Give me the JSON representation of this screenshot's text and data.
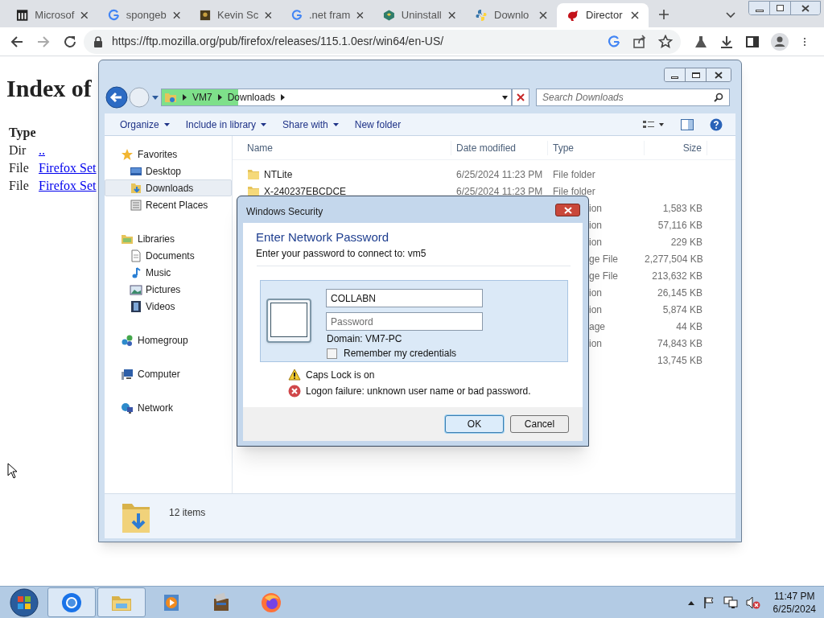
{
  "browser": {
    "tabs": [
      {
        "kind": "columns",
        "label": "Microsof",
        "selected": false
      },
      {
        "kind": "g",
        "label": "spongeb",
        "selected": false
      },
      {
        "kind": "photo",
        "label": "Kevin Sc",
        "selected": false
      },
      {
        "kind": "g",
        "label": ".net fram",
        "selected": false
      },
      {
        "kind": "cube",
        "label": "Uninstall",
        "selected": false
      },
      {
        "kind": "snake",
        "label": "Downlo",
        "selected": false
      },
      {
        "kind": "dino",
        "label": "Director",
        "selected": true
      }
    ],
    "address": "https://ftp.mozilla.org/pub/firefox/releases/115.1.0esr/win64/en-US/"
  },
  "page": {
    "heading": "Index of",
    "header": "Type",
    "rows": [
      {
        "type": "Dir",
        "link": ".."
      },
      {
        "type": "File",
        "link": "Firefox Set"
      },
      {
        "type": "File",
        "link": "Firefox Set"
      }
    ]
  },
  "explorer": {
    "breadcrumb": [
      "VM7",
      "Downloads"
    ],
    "progress": {
      "level": 0.22
    },
    "search_placeholder": "Search Downloads",
    "toolbar": [
      {
        "label": "Organize",
        "menu": true
      },
      {
        "label": "Include in library",
        "menu": true
      },
      {
        "label": "Share with",
        "menu": true
      },
      {
        "label": "New folder",
        "menu": false
      }
    ],
    "nav": [
      {
        "kind": "star",
        "label": "Favorites",
        "selected": false,
        "children": [
          {
            "kind": "desktop",
            "label": "Desktop",
            "selected": false
          },
          {
            "kind": "download",
            "label": "Downloads",
            "selected": true
          },
          {
            "kind": "recent",
            "label": "Recent Places",
            "selected": false
          }
        ]
      },
      {
        "kind": "library",
        "label": "Libraries",
        "selected": false,
        "children": [
          {
            "kind": "doc",
            "label": "Documents",
            "selected": false
          },
          {
            "kind": "music",
            "label": "Music",
            "selected": false
          },
          {
            "kind": "pictures",
            "label": "Pictures",
            "selected": false
          },
          {
            "kind": "video",
            "label": "Videos",
            "selected": false
          }
        ]
      },
      {
        "kind": "homegroup",
        "label": "Homegroup",
        "selected": false
      },
      {
        "kind": "computer",
        "label": "Computer",
        "selected": false
      },
      {
        "kind": "network",
        "label": "Network",
        "selected": false
      }
    ],
    "columns": [
      "Name",
      "Date modified",
      "Type",
      "Size"
    ],
    "rows": [
      {
        "name": "NTLite",
        "date": "6/25/2024 11:23 PM",
        "type": "File folder"
      },
      {
        "name": "X-240237EBCDCE",
        "date": "6/25/2024 11:23 PM",
        "type": "File folder"
      },
      {
        "type": "ion",
        "size": "1,583 KB"
      },
      {
        "type": "ion",
        "size": "57,116 KB"
      },
      {
        "type": "ion",
        "size": "229 KB"
      },
      {
        "type": "ge File",
        "size": "2,277,504 KB"
      },
      {
        "type": "ge File",
        "size": "213,632 KB"
      },
      {
        "type": "ion",
        "size": "26,145 KB"
      },
      {
        "type": "ion",
        "size": "5,874 KB"
      },
      {
        "type": "age",
        "size": "44 KB"
      },
      {
        "type": "ion",
        "size": "74,843 KB"
      },
      {
        "size": "13,745 KB"
      }
    ],
    "status": "12 items"
  },
  "dialog": {
    "title": "Windows Security",
    "heading": "Enter Network Password",
    "subtitle": "Enter your password to connect to: vm5",
    "username": "COLLABN",
    "password_placeholder": "Password",
    "domain": "Domain: VM7-PC",
    "remember": {
      "label": "Remember my credentials",
      "checked": false
    },
    "messages": [
      {
        "kind": "warning",
        "text": "Caps Lock is on"
      },
      {
        "kind": "error",
        "text": "Logon failure: unknown user name or bad password."
      }
    ],
    "buttons": [
      {
        "label": "OK",
        "default": true
      },
      {
        "label": "Cancel",
        "default": false
      }
    ]
  },
  "taskbar": {
    "apps": [
      {
        "kind": "chrome",
        "active": true
      },
      {
        "kind": "explorer",
        "active": true
      },
      {
        "kind": "media",
        "active": false
      },
      {
        "kind": "archive",
        "active": false
      },
      {
        "kind": "firefox",
        "active": false
      }
    ],
    "time": "11:47 PM",
    "date": "6/25/2024"
  }
}
